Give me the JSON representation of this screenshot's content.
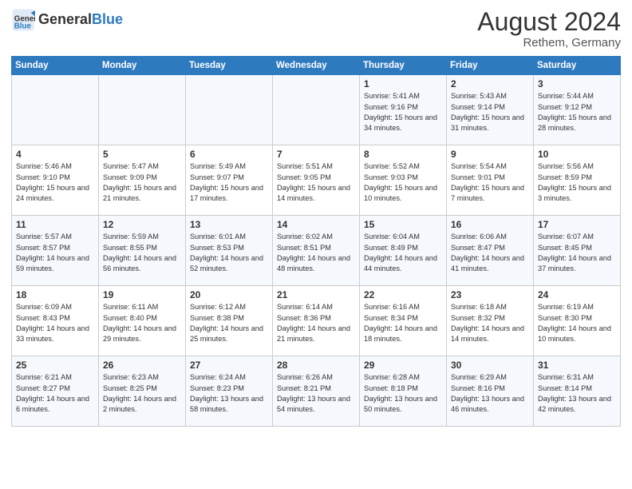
{
  "header": {
    "logo_line1": "General",
    "logo_line2": "Blue",
    "month_year": "August 2024",
    "location": "Rethem, Germany"
  },
  "days_of_week": [
    "Sunday",
    "Monday",
    "Tuesday",
    "Wednesday",
    "Thursday",
    "Friday",
    "Saturday"
  ],
  "weeks": [
    [
      {
        "day": "",
        "sunrise": "",
        "sunset": "",
        "daylight": ""
      },
      {
        "day": "",
        "sunrise": "",
        "sunset": "",
        "daylight": ""
      },
      {
        "day": "",
        "sunrise": "",
        "sunset": "",
        "daylight": ""
      },
      {
        "day": "",
        "sunrise": "",
        "sunset": "",
        "daylight": ""
      },
      {
        "day": "1",
        "sunrise": "Sunrise: 5:41 AM",
        "sunset": "Sunset: 9:16 PM",
        "daylight": "Daylight: 15 hours and 34 minutes."
      },
      {
        "day": "2",
        "sunrise": "Sunrise: 5:43 AM",
        "sunset": "Sunset: 9:14 PM",
        "daylight": "Daylight: 15 hours and 31 minutes."
      },
      {
        "day": "3",
        "sunrise": "Sunrise: 5:44 AM",
        "sunset": "Sunset: 9:12 PM",
        "daylight": "Daylight: 15 hours and 28 minutes."
      }
    ],
    [
      {
        "day": "4",
        "sunrise": "Sunrise: 5:46 AM",
        "sunset": "Sunset: 9:10 PM",
        "daylight": "Daylight: 15 hours and 24 minutes."
      },
      {
        "day": "5",
        "sunrise": "Sunrise: 5:47 AM",
        "sunset": "Sunset: 9:09 PM",
        "daylight": "Daylight: 15 hours and 21 minutes."
      },
      {
        "day": "6",
        "sunrise": "Sunrise: 5:49 AM",
        "sunset": "Sunset: 9:07 PM",
        "daylight": "Daylight: 15 hours and 17 minutes."
      },
      {
        "day": "7",
        "sunrise": "Sunrise: 5:51 AM",
        "sunset": "Sunset: 9:05 PM",
        "daylight": "Daylight: 15 hours and 14 minutes."
      },
      {
        "day": "8",
        "sunrise": "Sunrise: 5:52 AM",
        "sunset": "Sunset: 9:03 PM",
        "daylight": "Daylight: 15 hours and 10 minutes."
      },
      {
        "day": "9",
        "sunrise": "Sunrise: 5:54 AM",
        "sunset": "Sunset: 9:01 PM",
        "daylight": "Daylight: 15 hours and 7 minutes."
      },
      {
        "day": "10",
        "sunrise": "Sunrise: 5:56 AM",
        "sunset": "Sunset: 8:59 PM",
        "daylight": "Daylight: 15 hours and 3 minutes."
      }
    ],
    [
      {
        "day": "11",
        "sunrise": "Sunrise: 5:57 AM",
        "sunset": "Sunset: 8:57 PM",
        "daylight": "Daylight: 14 hours and 59 minutes."
      },
      {
        "day": "12",
        "sunrise": "Sunrise: 5:59 AM",
        "sunset": "Sunset: 8:55 PM",
        "daylight": "Daylight: 14 hours and 56 minutes."
      },
      {
        "day": "13",
        "sunrise": "Sunrise: 6:01 AM",
        "sunset": "Sunset: 8:53 PM",
        "daylight": "Daylight: 14 hours and 52 minutes."
      },
      {
        "day": "14",
        "sunrise": "Sunrise: 6:02 AM",
        "sunset": "Sunset: 8:51 PM",
        "daylight": "Daylight: 14 hours and 48 minutes."
      },
      {
        "day": "15",
        "sunrise": "Sunrise: 6:04 AM",
        "sunset": "Sunset: 8:49 PM",
        "daylight": "Daylight: 14 hours and 44 minutes."
      },
      {
        "day": "16",
        "sunrise": "Sunrise: 6:06 AM",
        "sunset": "Sunset: 8:47 PM",
        "daylight": "Daylight: 14 hours and 41 minutes."
      },
      {
        "day": "17",
        "sunrise": "Sunrise: 6:07 AM",
        "sunset": "Sunset: 8:45 PM",
        "daylight": "Daylight: 14 hours and 37 minutes."
      }
    ],
    [
      {
        "day": "18",
        "sunrise": "Sunrise: 6:09 AM",
        "sunset": "Sunset: 8:43 PM",
        "daylight": "Daylight: 14 hours and 33 minutes."
      },
      {
        "day": "19",
        "sunrise": "Sunrise: 6:11 AM",
        "sunset": "Sunset: 8:40 PM",
        "daylight": "Daylight: 14 hours and 29 minutes."
      },
      {
        "day": "20",
        "sunrise": "Sunrise: 6:12 AM",
        "sunset": "Sunset: 8:38 PM",
        "daylight": "Daylight: 14 hours and 25 minutes."
      },
      {
        "day": "21",
        "sunrise": "Sunrise: 6:14 AM",
        "sunset": "Sunset: 8:36 PM",
        "daylight": "Daylight: 14 hours and 21 minutes."
      },
      {
        "day": "22",
        "sunrise": "Sunrise: 6:16 AM",
        "sunset": "Sunset: 8:34 PM",
        "daylight": "Daylight: 14 hours and 18 minutes."
      },
      {
        "day": "23",
        "sunrise": "Sunrise: 6:18 AM",
        "sunset": "Sunset: 8:32 PM",
        "daylight": "Daylight: 14 hours and 14 minutes."
      },
      {
        "day": "24",
        "sunrise": "Sunrise: 6:19 AM",
        "sunset": "Sunset: 8:30 PM",
        "daylight": "Daylight: 14 hours and 10 minutes."
      }
    ],
    [
      {
        "day": "25",
        "sunrise": "Sunrise: 6:21 AM",
        "sunset": "Sunset: 8:27 PM",
        "daylight": "Daylight: 14 hours and 6 minutes."
      },
      {
        "day": "26",
        "sunrise": "Sunrise: 6:23 AM",
        "sunset": "Sunset: 8:25 PM",
        "daylight": "Daylight: 14 hours and 2 minutes."
      },
      {
        "day": "27",
        "sunrise": "Sunrise: 6:24 AM",
        "sunset": "Sunset: 8:23 PM",
        "daylight": "Daylight: 13 hours and 58 minutes."
      },
      {
        "day": "28",
        "sunrise": "Sunrise: 6:26 AM",
        "sunset": "Sunset: 8:21 PM",
        "daylight": "Daylight: 13 hours and 54 minutes."
      },
      {
        "day": "29",
        "sunrise": "Sunrise: 6:28 AM",
        "sunset": "Sunset: 8:18 PM",
        "daylight": "Daylight: 13 hours and 50 minutes."
      },
      {
        "day": "30",
        "sunrise": "Sunrise: 6:29 AM",
        "sunset": "Sunset: 8:16 PM",
        "daylight": "Daylight: 13 hours and 46 minutes."
      },
      {
        "day": "31",
        "sunrise": "Sunrise: 6:31 AM",
        "sunset": "Sunset: 8:14 PM",
        "daylight": "Daylight: 13 hours and 42 minutes."
      }
    ]
  ]
}
